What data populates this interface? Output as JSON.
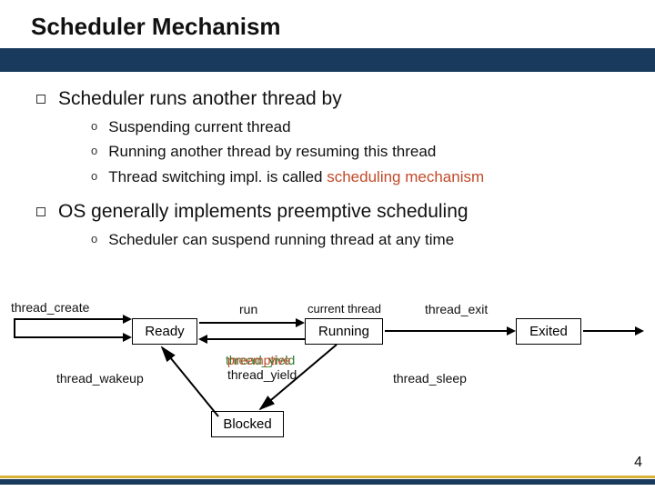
{
  "title": "Scheduler Mechanism",
  "bullets": {
    "b1": "Scheduler runs another thread by",
    "b1_sub": {
      "s1": "Suspending current thread",
      "s2": "Running another thread by resuming this thread",
      "s3a": "Thread switching impl. is called ",
      "s3b": "scheduling mechanism"
    },
    "b2": "OS generally implements preemptive scheduling",
    "b2_sub": {
      "s1": "Scheduler can suspend running thread at any time"
    }
  },
  "diagram": {
    "states": {
      "ready": "Ready",
      "running": "Running",
      "exited": "Exited",
      "blocked": "Blocked"
    },
    "labels": {
      "thread_create": "thread_create",
      "run": "run",
      "current_thread": "current thread",
      "thread_exit": "thread_exit",
      "thread_yield_g": "thread_yield",
      "preemptive": "preemptive",
      "thread_yield_b": "thread_yield",
      "thread_wakeup": "thread_wakeup",
      "thread_sleep": "thread_sleep"
    }
  },
  "page_number": "4"
}
